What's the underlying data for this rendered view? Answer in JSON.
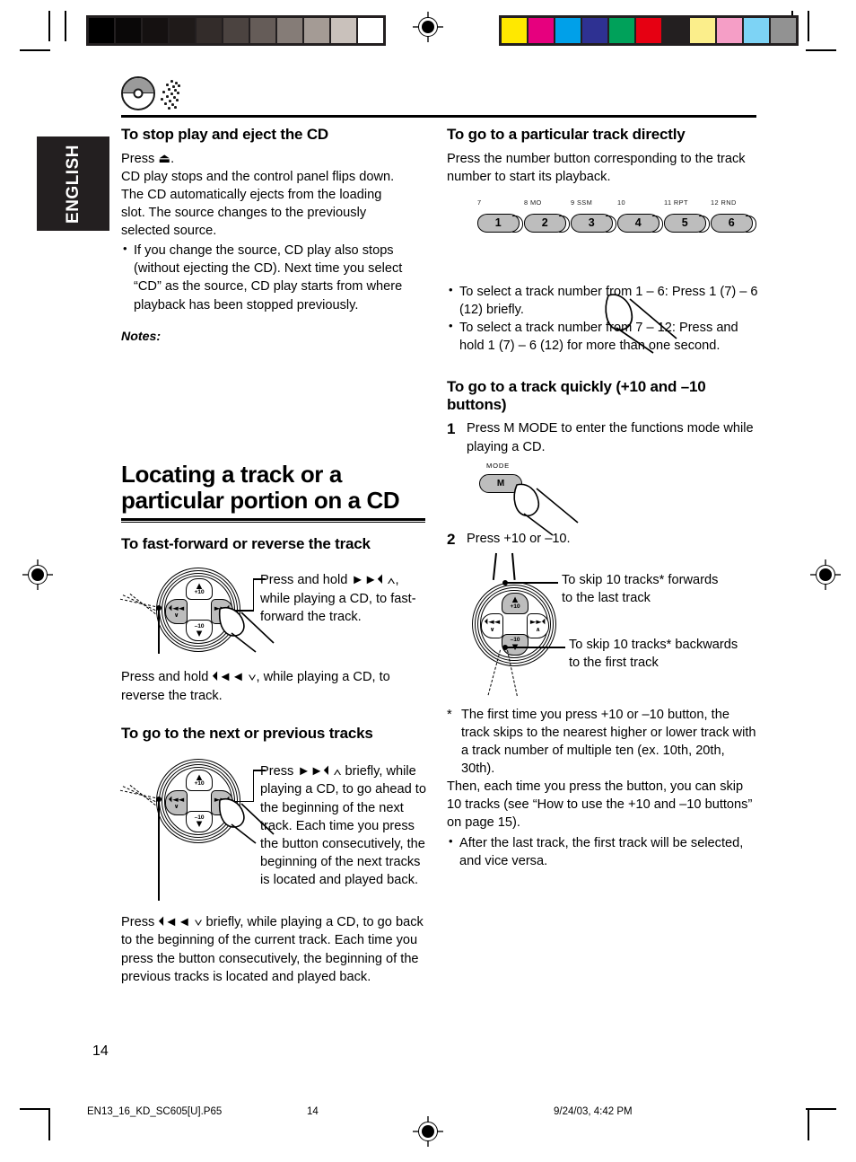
{
  "document": {
    "language_tab": "ENGLISH",
    "page_number": "14",
    "icon": "cd-disc-icon"
  },
  "footer": {
    "filename": "EN13_16_KD_SC605[U].P65",
    "page": "14",
    "timestamp": "9/24/03, 4:42 PM"
  },
  "calibration": {
    "grayscale": [
      "#000000",
      "#0a0808",
      "#151111",
      "#1f1a19",
      "#332c2a",
      "#4b4340",
      "#655c58",
      "#857c77",
      "#a49b95",
      "#c9c1bb",
      "#ffffff"
    ],
    "colors": [
      "#ffe800",
      "#e6007e",
      "#00a0e9",
      "#2e3192",
      "#00a15a",
      "#e60012",
      "#231f20",
      "#fbee8b",
      "#f59ec6",
      "#7dd3f5",
      "#929292"
    ]
  },
  "left_column": {
    "section1": {
      "heading": "To stop play and eject the CD",
      "para_lines": [
        "Press ⏏.",
        "CD play stops and the control panel flips down.",
        "The CD automatically ejects from the loading",
        "slot. The source changes to the previously",
        "selected source."
      ],
      "bullets": [
        "If you change the source, CD play also stops (without ejecting the CD). Next time you select “CD” as the source, CD play starts from where playback has been stopped previously."
      ],
      "notes_label": "Notes:"
    },
    "big_heading_line1": "Locating a track or a",
    "big_heading_line2": "particular portion on a CD",
    "section2": {
      "heading": "To fast-forward or reverse the track",
      "callout": "Press and hold ►►⏴ ∧, while playing a CD, to fast-forward the track.",
      "below": "Press and hold ⏴◄◄ ∨, while playing a CD, to reverse the track."
    },
    "section3": {
      "heading": "To go to the next or previous tracks",
      "callout": "Press ►►⏴ ∧ briefly, while playing a CD, to go ahead to the beginning of the next track. Each time you press the button consecutively, the beginning of the next tracks is located and played back.",
      "below": "Press ⏴◄◄ ∨ briefly, while playing a CD, to go back to the beginning of the current track. Each time you press the button consecutively, the beginning of the previous tracks is located and played back."
    }
  },
  "right_column": {
    "section1": {
      "heading": "To go to a particular track directly",
      "para": "Press the number button corresponding to the track number to start its playback.",
      "bullets": [
        "To select a track number from 1 – 6: Press 1 (7) – 6 (12) briefly.",
        "To select a track number from 7 – 12: Press and hold 1 (7) – 6 (12) for more than one second."
      ]
    },
    "number_buttons": [
      {
        "top": "7",
        "label": "1"
      },
      {
        "top": "8  MO",
        "label": "2"
      },
      {
        "top": "9  SSM",
        "label": "3"
      },
      {
        "top": "10",
        "label": "4"
      },
      {
        "top": "11  RPT",
        "label": "5"
      },
      {
        "top": "12  RND",
        "label": "6"
      }
    ],
    "section2": {
      "heading": "To go to a track quickly (+10 and –10 buttons)",
      "steps": [
        {
          "num": "1",
          "text": "Press M MODE to enter the functions mode while playing a CD."
        },
        {
          "num": "2",
          "text": "Press +10 or –10."
        }
      ],
      "mode_button": {
        "cap": "MODE",
        "label": "M"
      },
      "callout_forward_line1": "To skip 10 tracks* forwards",
      "callout_forward_line2": "to the last track",
      "callout_backward_line1": "To skip 10 tracks* backwards",
      "callout_backward_line2": "to the first track",
      "footnote_star": "*",
      "footnote": "The first time you press +10 or –10 button, the track skips to the nearest higher or lower track with a track number of multiple ten (ex. 10th, 20th, 30th).",
      "footnote_cont": "Then, each time you press the button, you can skip 10 tracks (see “How to use the +10 and –10 buttons” on page 15).",
      "footnote_bullet": "After the last track, the first track will be selected, and vice versa."
    }
  },
  "control_pad": {
    "up_label": "+10",
    "down_label": "–10",
    "left_glyph": "⏴◄◄",
    "right_glyph": "►►⏴",
    "up_glyph": "▲",
    "down_glyph": "▼",
    "left_chevron": "∨",
    "right_chevron": "∧"
  }
}
